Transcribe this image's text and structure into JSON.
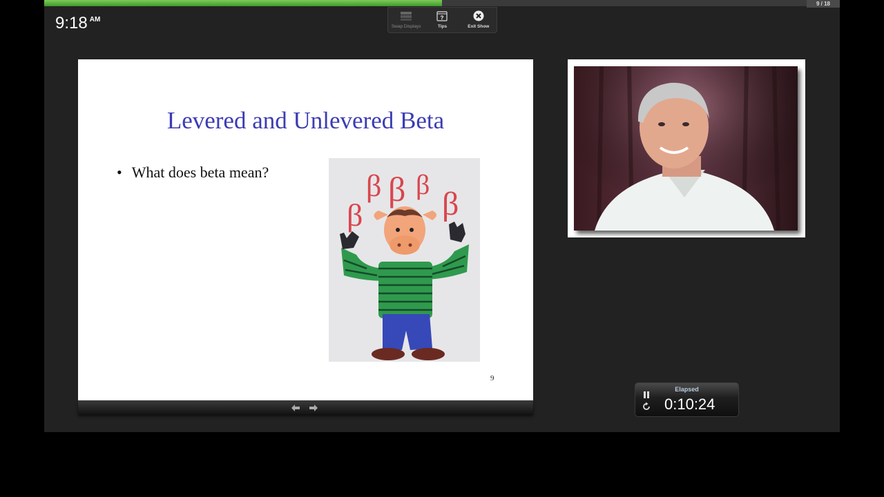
{
  "progress": {
    "current": 9,
    "total": 18,
    "fraction": 0.5,
    "counter_text": "9 / 18"
  },
  "clock": {
    "time": "9:18",
    "ampm": "AM"
  },
  "toolbar": {
    "swap_displays_label": "Swap Displays",
    "tips_label": "Tips",
    "exit_show_label": "Exit Show"
  },
  "slide": {
    "title": "Levered and Unlevered Beta",
    "bullet": "What does beta mean?",
    "page_number": "9",
    "image_glyph": "β"
  },
  "timer": {
    "label": "Elapsed",
    "value": "0:10:24"
  },
  "colors": {
    "slide_title": "#3c3cb4",
    "progress_fill": "#4caf3a",
    "background": "#222222"
  },
  "icons": [
    "swap-displays-icon",
    "tips-icon",
    "exit-show-icon",
    "prev-arrow-icon",
    "next-arrow-icon",
    "pause-icon",
    "reset-icon"
  ]
}
